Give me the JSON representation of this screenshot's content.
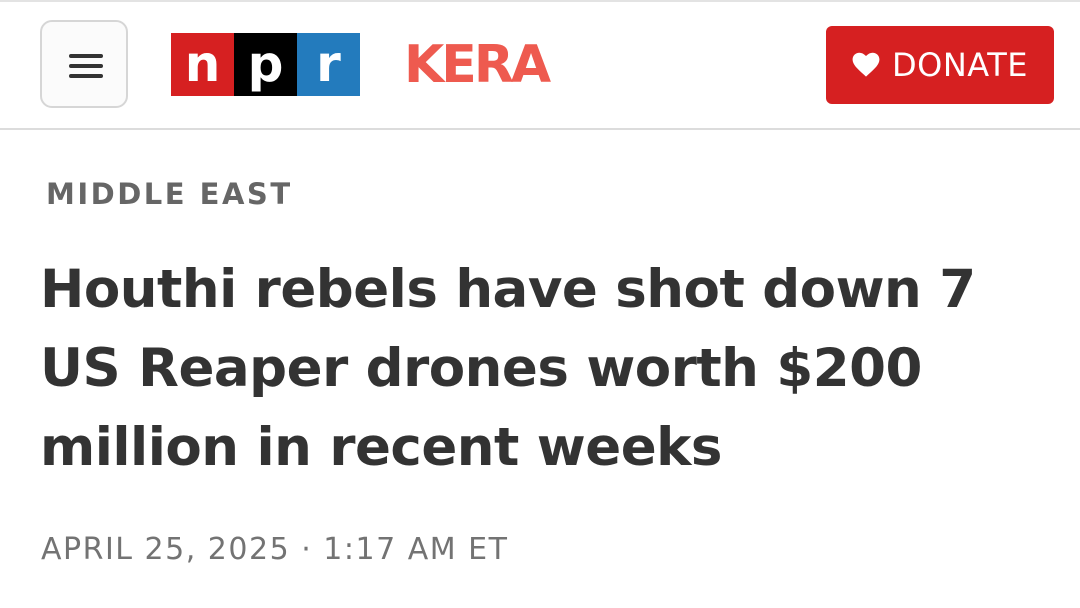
{
  "header": {
    "menu_icon": "hamburger-menu-icon",
    "logo": {
      "letters": [
        "n",
        "p",
        "r"
      ],
      "colors": [
        "#d62021",
        "#000000",
        "#237bbd"
      ]
    },
    "station": "KERA",
    "station_color": "#ee5a4f",
    "donate": {
      "label": "DONATE",
      "icon": "heart-icon",
      "color": "#d62021"
    }
  },
  "article": {
    "section": "MIDDLE EAST",
    "headline": "Houthi rebels have shot down 7 US Reaper drones worth $200 million in recent weeks",
    "date": "APRIL 25, 2025",
    "separator": "·",
    "time": "1:17 AM ET"
  }
}
